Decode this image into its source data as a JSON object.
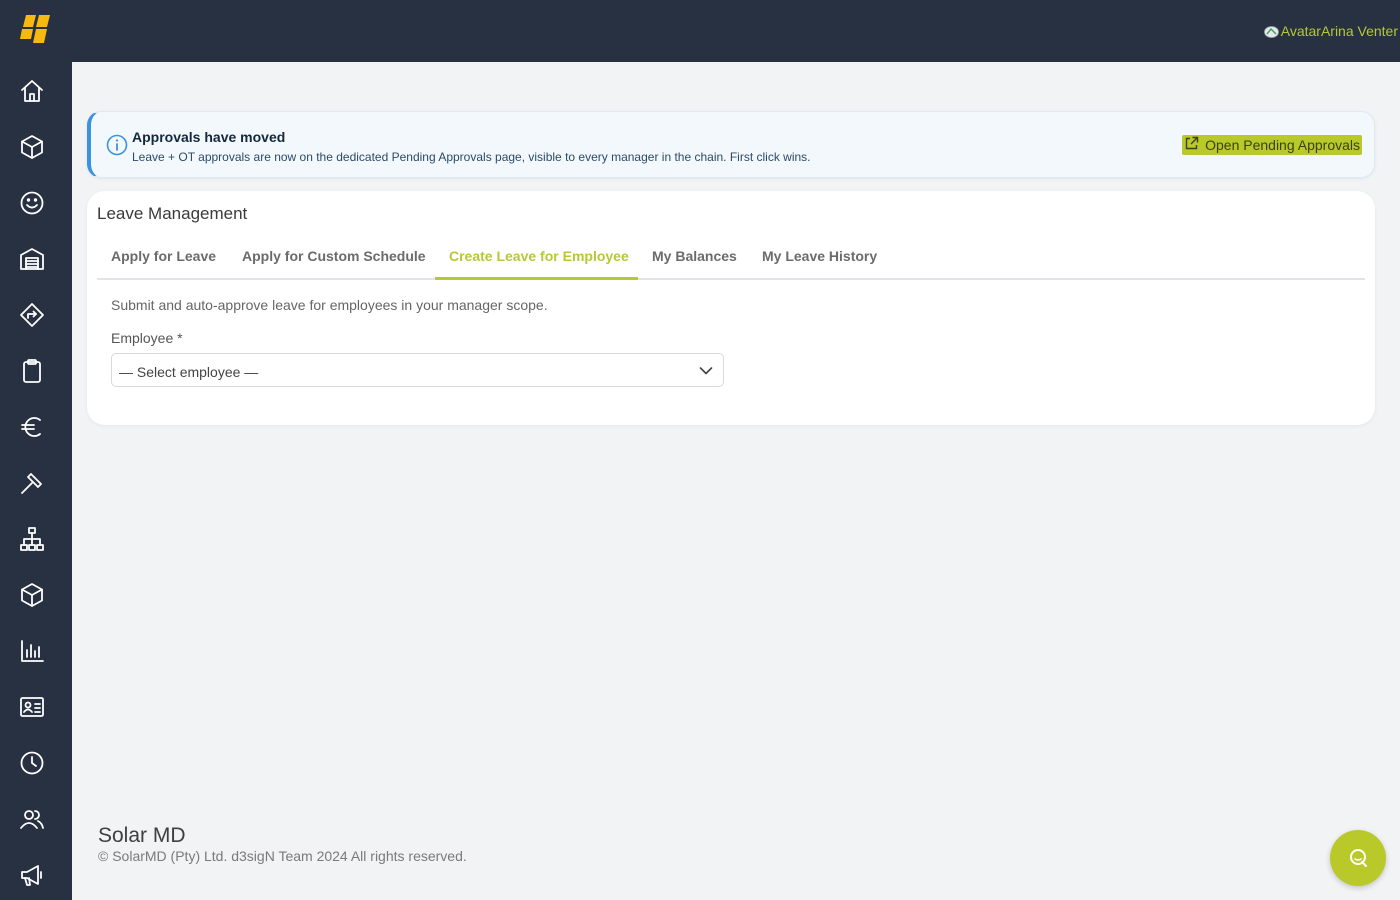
{
  "header": {
    "user_label": "AvatarArina Venter"
  },
  "sidebar": {
    "items": [
      {
        "icon": "home-icon"
      },
      {
        "icon": "cube-icon"
      },
      {
        "icon": "smiley-icon"
      },
      {
        "icon": "warehouse-icon"
      },
      {
        "icon": "directions-icon"
      },
      {
        "icon": "clipboard-icon"
      },
      {
        "icon": "euro-icon"
      },
      {
        "icon": "hammer-icon"
      },
      {
        "icon": "org-chart-icon"
      },
      {
        "icon": "box-icon"
      },
      {
        "icon": "bar-chart-icon"
      },
      {
        "icon": "id-card-icon"
      },
      {
        "icon": "clock-icon"
      },
      {
        "icon": "users-icon"
      },
      {
        "icon": "megaphone-icon"
      }
    ]
  },
  "banner": {
    "title": "Approvals have moved",
    "text": "Leave + OT approvals are now on the dedicated Pending Approvals page, visible to every manager in the chain. First click wins.",
    "button_label": "Open Pending Approvals"
  },
  "card": {
    "title": "Leave Management",
    "tabs": [
      {
        "label": "Apply for Leave"
      },
      {
        "label": "Apply for Custom Schedule"
      },
      {
        "label": "Create Leave for Employee"
      },
      {
        "label": "My Balances"
      },
      {
        "label": "My Leave History"
      }
    ],
    "active_tab": "Create Leave for Employee",
    "description": "Submit and auto-approve leave for employees in your manager scope.",
    "employee_label": "Employee *",
    "employee_select_value": "— Select employee —"
  },
  "footer": {
    "title": "Solar MD",
    "copyright": "© SolarMD (Pty) Ltd. d3sigN Team 2024 All rights reserved."
  },
  "colors": {
    "sidebar_bg": "#273142",
    "accent": "#b5c934",
    "banner_border": "#3a93e0",
    "page_bg": "#f2f3f5"
  }
}
